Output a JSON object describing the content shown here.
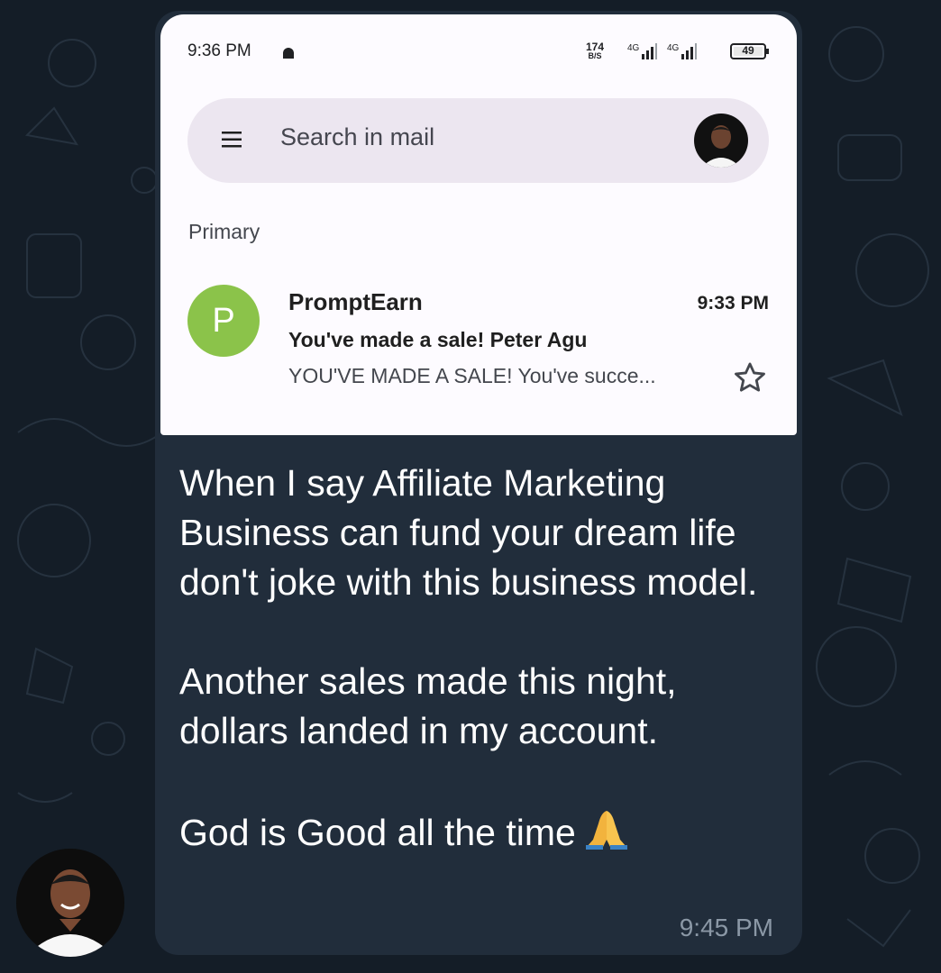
{
  "phone_status": {
    "time": "9:36 PM",
    "net_speed_value": "174",
    "net_speed_unit": "B/S",
    "signal_1": "4G",
    "signal_2": "4G",
    "battery": "49"
  },
  "gmail": {
    "search_placeholder": "Search in mail",
    "section_label": "Primary",
    "email": {
      "avatar_letter": "P",
      "avatar_color": "#8bc34a",
      "sender": "PromptEarn",
      "time": "9:33 PM",
      "subject": "You've made a sale! Peter Agu",
      "preview": "YOU'VE MADE A SALE! You've succe..."
    }
  },
  "message": {
    "paragraph_1": "When I say Affiliate Marketing Business can fund your dream life don't joke with this business model.",
    "paragraph_2": "Another sales made this night, dollars landed in my account.",
    "paragraph_3": "God is Good all the time",
    "emoji": "folded-hands-icon",
    "time": "9:45 PM"
  },
  "colors": {
    "chat_background": "#141d27",
    "bubble": "#212d3b",
    "timestamp": "#8b98a6",
    "search_bar": "#ece6f0"
  }
}
